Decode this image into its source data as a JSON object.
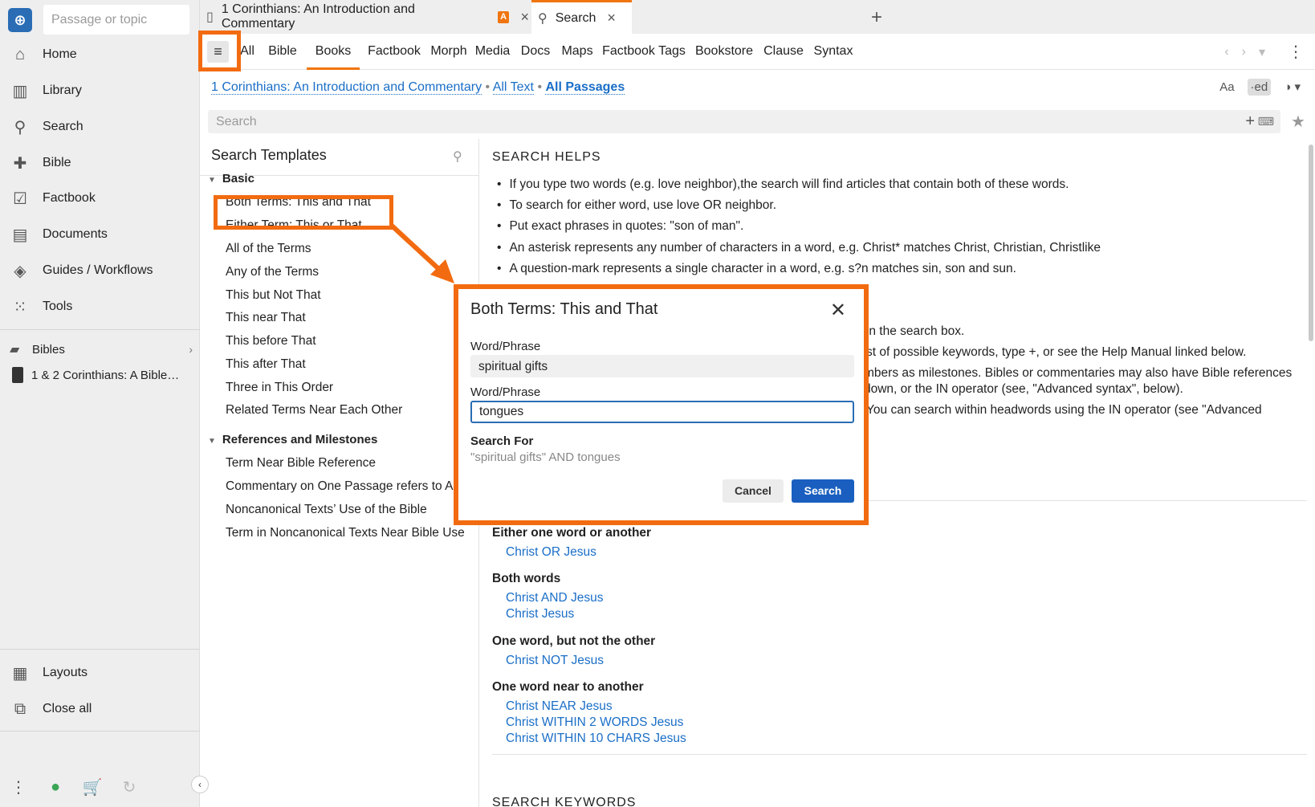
{
  "sidebar": {
    "passage_placeholder": "Passage or topic",
    "nav": [
      {
        "label": "Home",
        "icon": "home-icon"
      },
      {
        "label": "Library",
        "icon": "library-icon"
      },
      {
        "label": "Search",
        "icon": "search-icon"
      },
      {
        "label": "Bible",
        "icon": "bible-icon"
      },
      {
        "label": "Factbook",
        "icon": "factbook-icon"
      },
      {
        "label": "Documents",
        "icon": "documents-icon"
      },
      {
        "label": "Guides / Workflows",
        "icon": "guides-icon"
      },
      {
        "label": "Tools",
        "icon": "tools-icon"
      }
    ],
    "library": [
      {
        "label": "Bibles",
        "icon": "folder-icon"
      },
      {
        "label": "1 & 2 Corinthians: A Bible…",
        "icon": "book-icon"
      }
    ],
    "bottom": [
      {
        "label": "Layouts",
        "icon": "layouts-icon"
      },
      {
        "label": "Close all",
        "icon": "close-all-icon"
      }
    ]
  },
  "tabs": [
    {
      "label": "1 Corinthians: An Introduction and Commentary",
      "badge": "A"
    },
    {
      "label": "Search"
    }
  ],
  "toolbar": {
    "categories": [
      "All",
      "Bible",
      "Books",
      "Factbook",
      "Morph",
      "Media",
      "Docs",
      "Maps",
      "Factbook Tags",
      "Bookstore",
      "Clause",
      "Syntax"
    ],
    "active": "Books"
  },
  "crumbs": {
    "resource": "1 Corinthians: An Introduction and Commentary",
    "text": "All Text",
    "passages": "All Passages"
  },
  "search": {
    "placeholder": "Search"
  },
  "templates": {
    "title": "Search Templates",
    "groups": [
      {
        "label": "Basic",
        "items": [
          "Both Terms: This and That",
          "Either Term: This or That",
          "All of the Terms",
          "Any of the Terms",
          "This but Not That",
          "This near That",
          "This before That",
          "This after That",
          "Three in This Order",
          "Related Terms Near Each Other"
        ]
      },
      {
        "label": "References and Milestones",
        "items": [
          "Term Near Bible Reference",
          "Commentary on One Passage refers to An",
          "Noncanonical Texts’ Use of the Bible",
          "Term in Noncanonical Texts Near Bible Use"
        ]
      }
    ]
  },
  "help": {
    "heading": "SEARCH HELPS",
    "bullets": [
      "If you type two words (e.g. love neighbor),the search will find articles that contain both of these words.",
      "To search for either word, use love OR neighbor.",
      "Put exact phrases in quotes: \"son of man\".",
      "An asterisk represents any number of characters in a word, e.g. Christ* matches Christ, Christian, Christlike",
      "A question-mark represents a single character in a word, e.g. s?n matches sin, son and sun."
    ],
    "partials": [
      "n in the search box.",
      "st of possible keywords, type +, or see the Help Manual linked below.",
      "mbers as milestones. Bibles or commentaries may also have Bible references",
      "down, or the IN operator (see, \"Advanced syntax\", below).",
      "You can search within headwords using the IN operator (see \"Advanced"
    ],
    "examples": [
      {
        "heading": "Either one word or another",
        "links": [
          "Christ OR Jesus"
        ]
      },
      {
        "heading": "Both words",
        "links": [
          "Christ AND Jesus",
          "Christ Jesus"
        ]
      },
      {
        "heading": "One word, but not the other",
        "links": [
          "Christ NOT Jesus"
        ]
      },
      {
        "heading": "One word near to another",
        "links": [
          "Christ NEAR Jesus",
          "Christ WITHIN 2 WORDS Jesus",
          "Christ WITHIN 10 CHARS Jesus"
        ]
      }
    ],
    "next_heading": "SEARCH KEYWORDS"
  },
  "dialog": {
    "title": "Both Terms: This and That",
    "label1": "Word/Phrase",
    "value1": "spiritual gifts",
    "label2": "Word/Phrase",
    "value2": "tongues",
    "search_for_label": "Search For",
    "search_for_value": "\"spiritual gifts\" AND tongues",
    "cancel": "Cancel",
    "submit": "Search"
  },
  "colors": {
    "accent": "#f0750f",
    "highlight": "#f26b10",
    "link": "#1a6ec7",
    "primary_button": "#1a5fbf"
  }
}
